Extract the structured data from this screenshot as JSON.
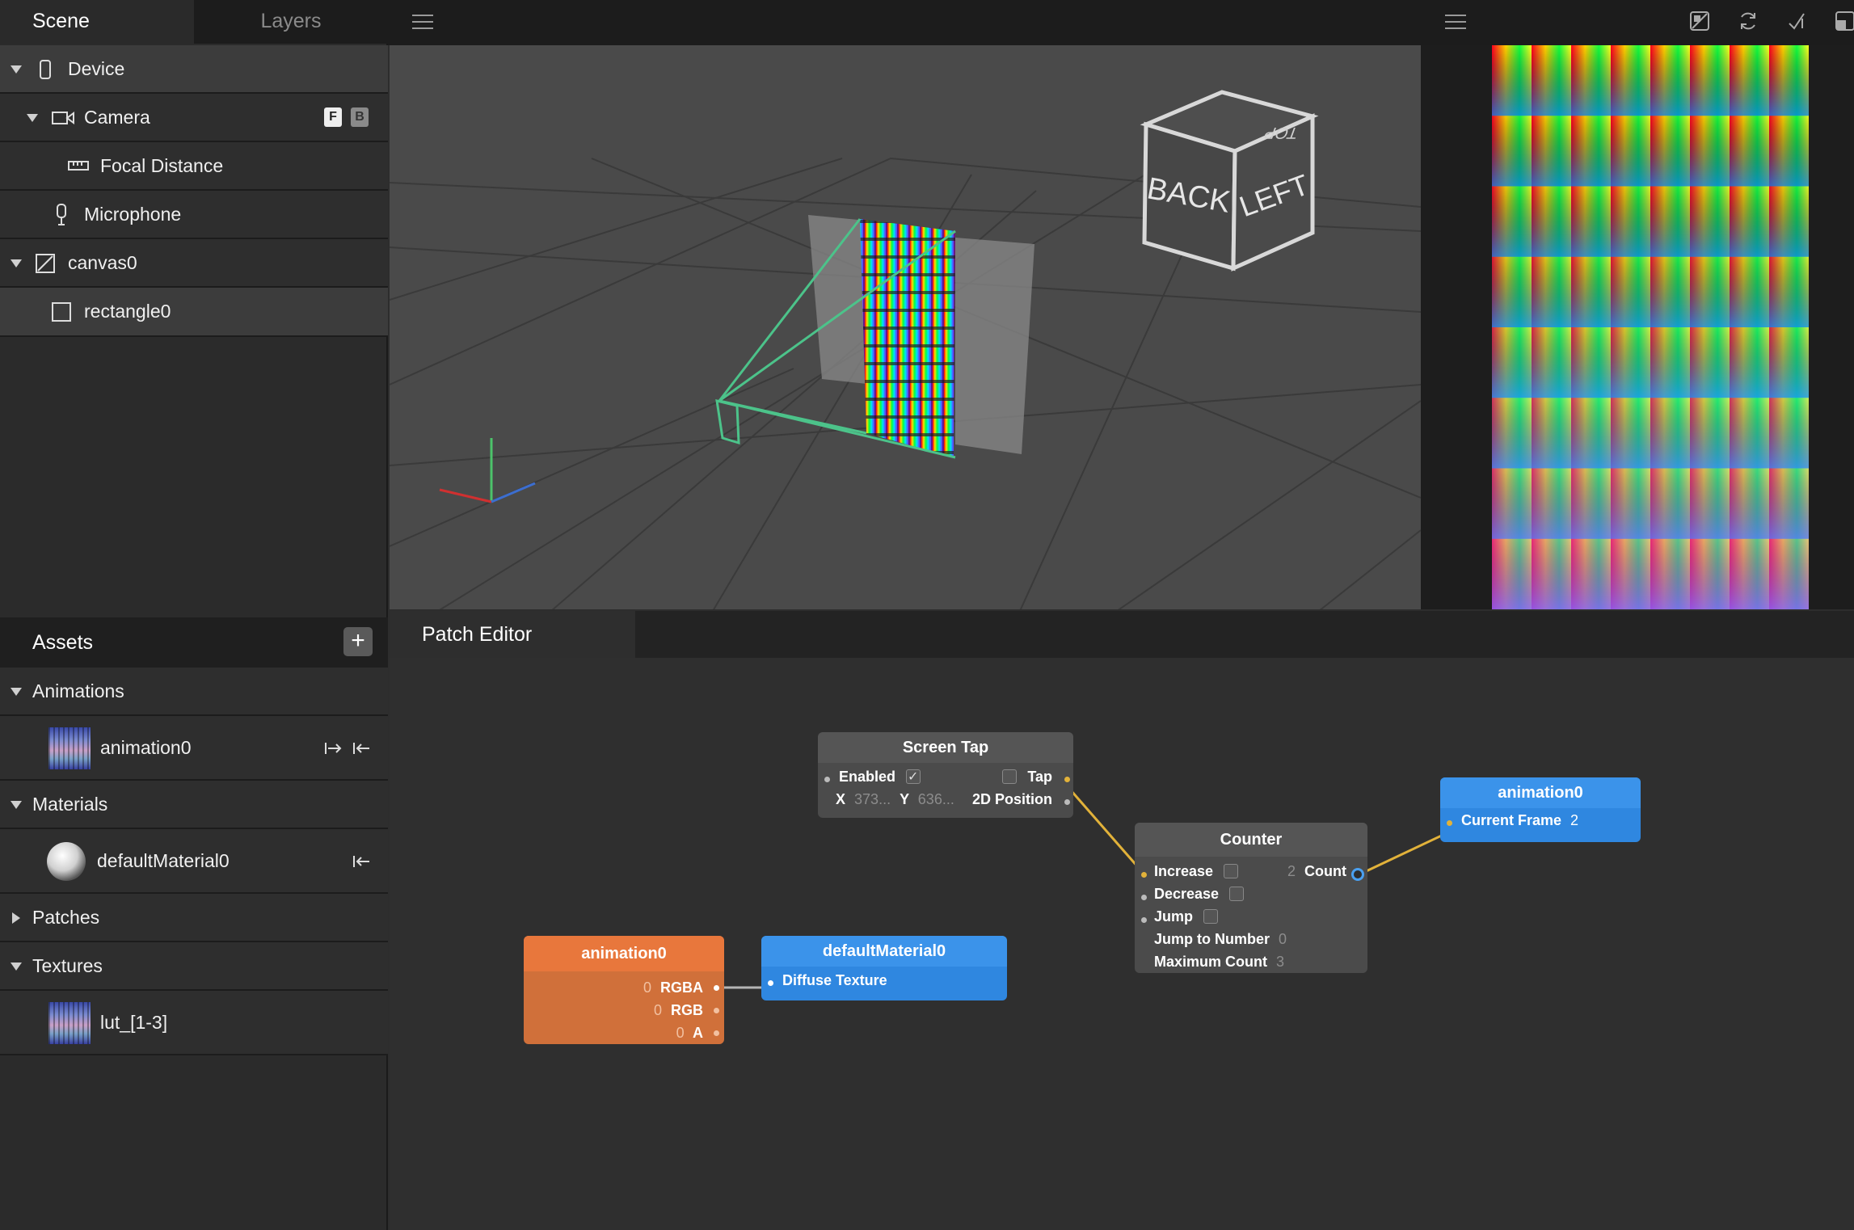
{
  "scene_panel": {
    "tabs": [
      "Scene",
      "Layers"
    ],
    "items": [
      {
        "label": "Device"
      },
      {
        "label": "Camera",
        "badges": [
          "F",
          "B"
        ]
      },
      {
        "label": "Focal Distance"
      },
      {
        "label": "Microphone"
      },
      {
        "label": "canvas0"
      },
      {
        "label": "rectangle0"
      }
    ]
  },
  "assets_panel": {
    "title": "Assets",
    "add_label": "+",
    "sections": [
      {
        "label": "Animations",
        "items": [
          {
            "label": "animation0"
          }
        ]
      },
      {
        "label": "Materials",
        "items": [
          {
            "label": "defaultMaterial0"
          }
        ]
      },
      {
        "label": "Patches",
        "items": []
      },
      {
        "label": "Textures",
        "items": [
          {
            "label": "lut_[1-3]"
          }
        ]
      }
    ]
  },
  "viewport": {
    "cube_labels": {
      "top": "TOP",
      "back": "BACK",
      "left": "LEFT"
    }
  },
  "patch_editor": {
    "tab_label": "Patch Editor",
    "nodes": {
      "screen_tap": {
        "title": "Screen Tap",
        "enabled_label": "Enabled",
        "tap_label": "Tap",
        "x_label": "X",
        "x_value": "373...",
        "y_label": "Y",
        "y_value": "636...",
        "position_label": "2D Position"
      },
      "counter": {
        "title": "Counter",
        "inputs": [
          {
            "label": "Increase"
          },
          {
            "label": "Decrease"
          },
          {
            "label": "Jump"
          },
          {
            "label": "Jump to Number",
            "value": "0"
          },
          {
            "label": "Maximum Count",
            "value": "3"
          }
        ],
        "output_label": "Count",
        "output_value": "2"
      },
      "animation_out": {
        "title": "animation0",
        "input_label": "Current Frame",
        "input_value": "2"
      },
      "animation_src": {
        "title": "animation0",
        "outputs": [
          {
            "label": "RGBA",
            "value": "0"
          },
          {
            "label": "RGB",
            "value": "0"
          },
          {
            "label": "A",
            "value": "0"
          }
        ]
      },
      "material": {
        "title": "defaultMaterial0",
        "input_label": "Diffuse Texture"
      }
    },
    "colors": {
      "node_gray": "#4b4b4b",
      "node_blue": "#2f87e0",
      "node_orange": "#e8773c",
      "wire_yellow": "#e2b23a",
      "wire_gray": "#b5b5b5"
    }
  }
}
